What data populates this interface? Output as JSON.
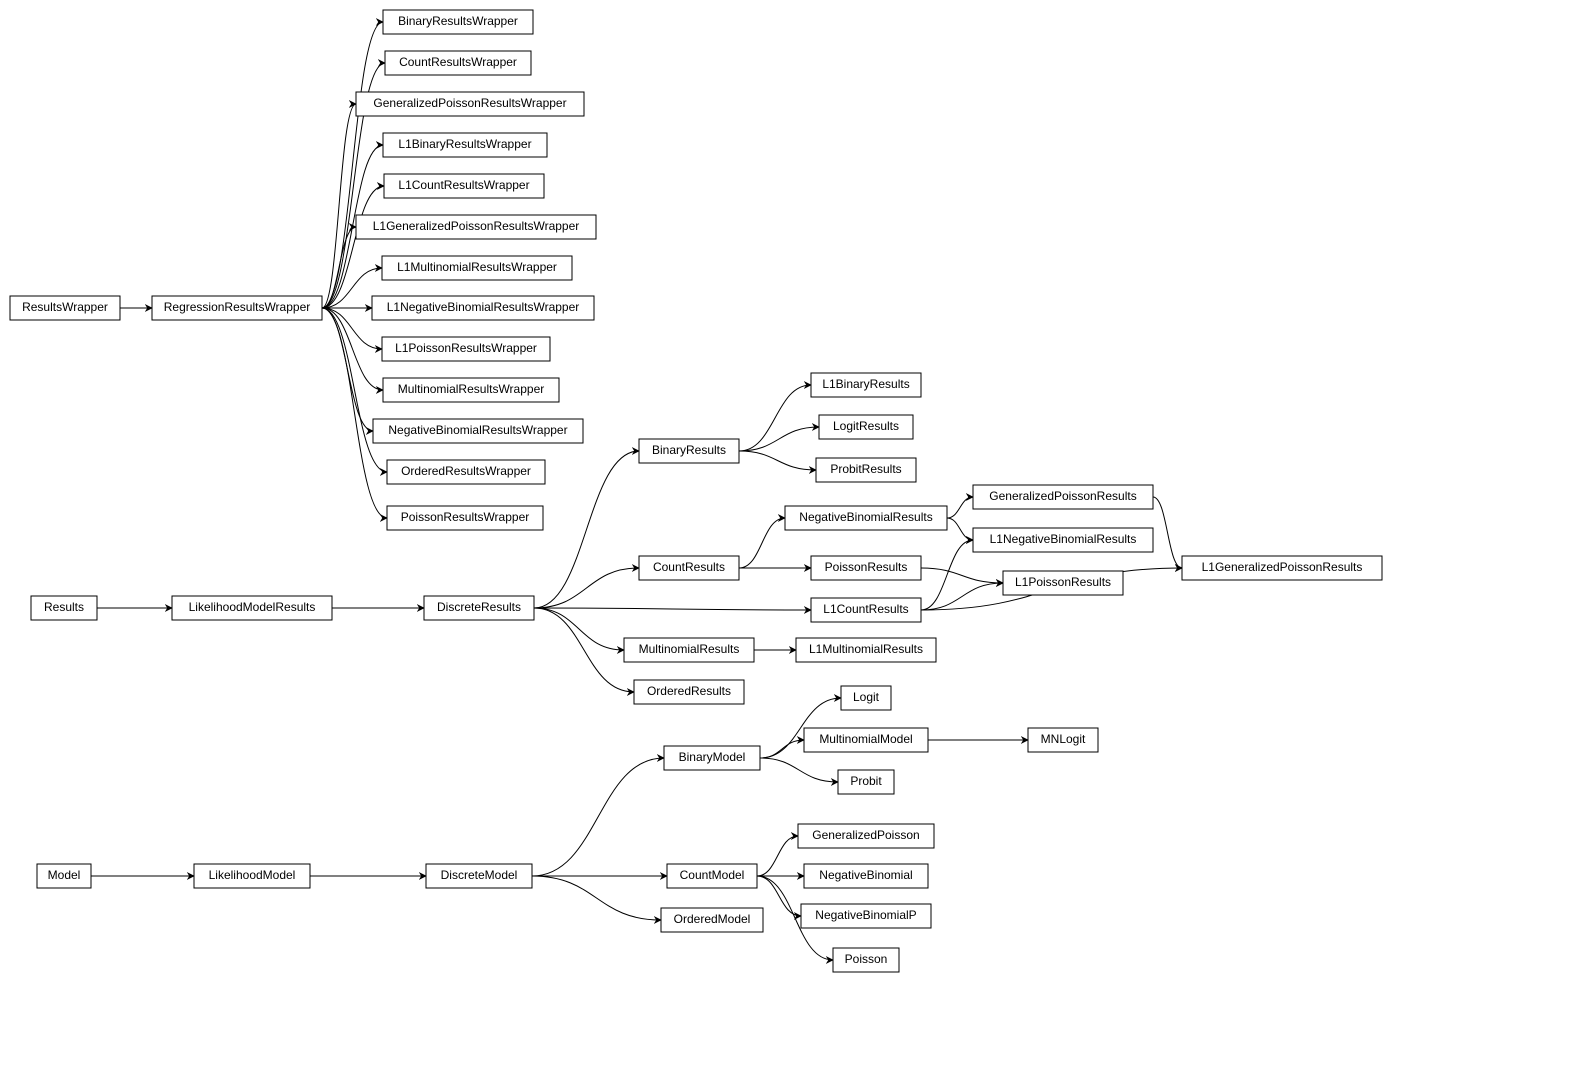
{
  "diagram": {
    "type": "class-hierarchy",
    "nodes": {
      "ResultsWrapper": "ResultsWrapper",
      "RegressionResultsWrapper": "RegressionResultsWrapper",
      "BinaryResultsWrapper": "BinaryResultsWrapper",
      "CountResultsWrapper": "CountResultsWrapper",
      "GeneralizedPoissonResultsWrapper": "GeneralizedPoissonResultsWrapper",
      "L1BinaryResultsWrapper": "L1BinaryResultsWrapper",
      "L1CountResultsWrapper": "L1CountResultsWrapper",
      "L1GeneralizedPoissonResultsWrapper": "L1GeneralizedPoissonResultsWrapper",
      "L1MultinomialResultsWrapper": "L1MultinomialResultsWrapper",
      "L1NegativeBinomialResultsWrapper": "L1NegativeBinomialResultsWrapper",
      "L1PoissonResultsWrapper": "L1PoissonResultsWrapper",
      "MultinomialResultsWrapper": "MultinomialResultsWrapper",
      "NegativeBinomialResultsWrapper": "NegativeBinomialResultsWrapper",
      "OrderedResultsWrapper": "OrderedResultsWrapper",
      "PoissonResultsWrapper": "PoissonResultsWrapper",
      "Results": "Results",
      "LikelihoodModelResults": "LikelihoodModelResults",
      "DiscreteResults": "DiscreteResults",
      "BinaryResults": "BinaryResults",
      "L1BinaryResults": "L1BinaryResults",
      "LogitResults": "LogitResults",
      "ProbitResults": "ProbitResults",
      "CountResults": "CountResults",
      "NegativeBinomialResults": "NegativeBinomialResults",
      "PoissonResults": "PoissonResults",
      "L1CountResults": "L1CountResults",
      "GeneralizedPoissonResults": "GeneralizedPoissonResults",
      "L1NegativeBinomialResults": "L1NegativeBinomialResults",
      "L1PoissonResults": "L1PoissonResults",
      "L1GeneralizedPoissonResults": "L1GeneralizedPoissonResults",
      "MultinomialResults": "MultinomialResults",
      "L1MultinomialResults": "L1MultinomialResults",
      "OrderedResults": "OrderedResults",
      "Model": "Model",
      "LikelihoodModel": "LikelihoodModel",
      "DiscreteModel": "DiscreteModel",
      "BinaryModel": "BinaryModel",
      "Logit": "Logit",
      "MultinomialModel": "MultinomialModel",
      "Probit": "Probit",
      "MNLogit": "MNLogit",
      "CountModel": "CountModel",
      "GeneralizedPoisson": "GeneralizedPoisson",
      "NegativeBinomial": "NegativeBinomial",
      "NegativeBinomialP": "NegativeBinomialP",
      "Poisson": "Poisson",
      "OrderedModel": "OrderedModel"
    },
    "edges": [
      [
        "ResultsWrapper",
        "RegressionResultsWrapper"
      ],
      [
        "RegressionResultsWrapper",
        "BinaryResultsWrapper"
      ],
      [
        "RegressionResultsWrapper",
        "CountResultsWrapper"
      ],
      [
        "RegressionResultsWrapper",
        "GeneralizedPoissonResultsWrapper"
      ],
      [
        "RegressionResultsWrapper",
        "L1BinaryResultsWrapper"
      ],
      [
        "RegressionResultsWrapper",
        "L1CountResultsWrapper"
      ],
      [
        "RegressionResultsWrapper",
        "L1GeneralizedPoissonResultsWrapper"
      ],
      [
        "RegressionResultsWrapper",
        "L1MultinomialResultsWrapper"
      ],
      [
        "RegressionResultsWrapper",
        "L1NegativeBinomialResultsWrapper"
      ],
      [
        "RegressionResultsWrapper",
        "L1PoissonResultsWrapper"
      ],
      [
        "RegressionResultsWrapper",
        "MultinomialResultsWrapper"
      ],
      [
        "RegressionResultsWrapper",
        "NegativeBinomialResultsWrapper"
      ],
      [
        "RegressionResultsWrapper",
        "OrderedResultsWrapper"
      ],
      [
        "RegressionResultsWrapper",
        "PoissonResultsWrapper"
      ],
      [
        "Results",
        "LikelihoodModelResults"
      ],
      [
        "LikelihoodModelResults",
        "DiscreteResults"
      ],
      [
        "DiscreteResults",
        "BinaryResults"
      ],
      [
        "DiscreteResults",
        "CountResults"
      ],
      [
        "DiscreteResults",
        "L1CountResults"
      ],
      [
        "DiscreteResults",
        "MultinomialResults"
      ],
      [
        "DiscreteResults",
        "OrderedResults"
      ],
      [
        "BinaryResults",
        "L1BinaryResults"
      ],
      [
        "BinaryResults",
        "LogitResults"
      ],
      [
        "BinaryResults",
        "ProbitResults"
      ],
      [
        "CountResults",
        "NegativeBinomialResults"
      ],
      [
        "CountResults",
        "PoissonResults"
      ],
      [
        "NegativeBinomialResults",
        "GeneralizedPoissonResults"
      ],
      [
        "NegativeBinomialResults",
        "L1NegativeBinomialResults"
      ],
      [
        "PoissonResults",
        "L1PoissonResults"
      ],
      [
        "L1CountResults",
        "L1NegativeBinomialResults"
      ],
      [
        "L1CountResults",
        "L1PoissonResults"
      ],
      [
        "L1CountResults",
        "L1GeneralizedPoissonResults"
      ],
      [
        "GeneralizedPoissonResults",
        "L1GeneralizedPoissonResults"
      ],
      [
        "MultinomialResults",
        "L1MultinomialResults"
      ],
      [
        "Model",
        "LikelihoodModel"
      ],
      [
        "LikelihoodModel",
        "DiscreteModel"
      ],
      [
        "DiscreteModel",
        "BinaryModel"
      ],
      [
        "DiscreteModel",
        "CountModel"
      ],
      [
        "DiscreteModel",
        "OrderedModel"
      ],
      [
        "BinaryModel",
        "Logit"
      ],
      [
        "BinaryModel",
        "MultinomialModel"
      ],
      [
        "BinaryModel",
        "Probit"
      ],
      [
        "MultinomialModel",
        "MNLogit"
      ],
      [
        "CountModel",
        "GeneralizedPoisson"
      ],
      [
        "CountModel",
        "NegativeBinomial"
      ],
      [
        "CountModel",
        "NegativeBinomialP"
      ],
      [
        "CountModel",
        "Poisson"
      ]
    ]
  }
}
